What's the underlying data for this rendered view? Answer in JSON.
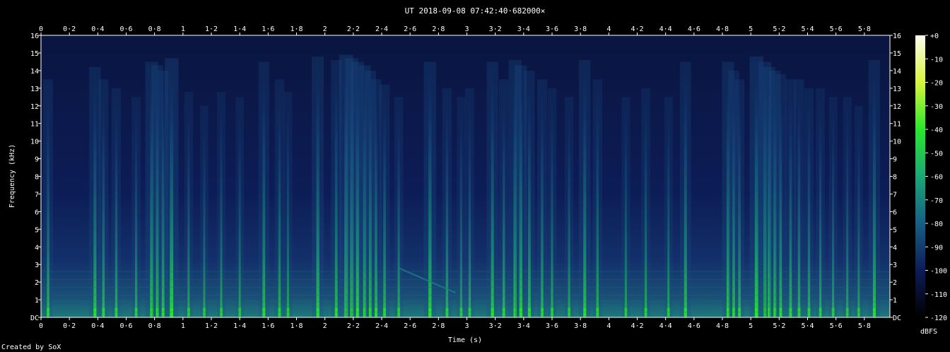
{
  "title": "UT 2018-09-08 07:42:40·682000×",
  "credit": "Created by SoX",
  "chart_data": {
    "type": "heatmap",
    "title": "UT 2018-09-08 07:42:40·682000×",
    "xlabel": "Time (s)",
    "ylabel": "Frequency (kHz)",
    "xlim": [
      0,
      5.98
    ],
    "ylim": [
      0,
      16
    ],
    "x_ticks": [
      "0",
      "0·2",
      "0·4",
      "0·6",
      "0·8",
      "1",
      "1·2",
      "1·4",
      "1·6",
      "1·8",
      "2",
      "2·2",
      "2·4",
      "2·6",
      "2·8",
      "3",
      "3·2",
      "3·4",
      "3·6",
      "3·8",
      "4",
      "4·2",
      "4·4",
      "4·6",
      "4·8",
      "5",
      "5·2",
      "5·4",
      "5·6",
      "5·8"
    ],
    "x_tick_values": [
      0,
      0.2,
      0.4,
      0.6,
      0.8,
      1.0,
      1.2,
      1.4,
      1.6,
      1.8,
      2.0,
      2.2,
      2.4,
      2.6,
      2.8,
      3.0,
      3.2,
      3.4,
      3.6,
      3.8,
      4.0,
      4.2,
      4.4,
      4.6,
      4.8,
      5.0,
      5.2,
      5.4,
      5.6,
      5.8
    ],
    "y_ticks": [
      "DC",
      "1",
      "2",
      "3",
      "4",
      "5",
      "6",
      "7",
      "8",
      "9",
      "10",
      "11",
      "12",
      "13",
      "14",
      "15",
      "16"
    ],
    "y_tick_values": [
      0,
      1,
      2,
      3,
      4,
      5,
      6,
      7,
      8,
      9,
      10,
      11,
      12,
      13,
      14,
      15,
      16
    ],
    "colorbar": {
      "label": "dBFS",
      "ticks": [
        "+0",
        "-10",
        "-20",
        "-30",
        "-40",
        "-50",
        "-60",
        "-70",
        "-80",
        "-90",
        "-100",
        "-110",
        "-120"
      ],
      "range": [
        -120,
        0
      ],
      "colors": [
        "#fdfdf0",
        "#d8f53a",
        "#27e82b",
        "#1ba776",
        "#155f86",
        "#0d1c58",
        "#000000"
      ]
    },
    "background_color": "#0a1540",
    "transients": [
      {
        "t": 0.05,
        "top": 13.5,
        "amp": 0.5
      },
      {
        "t": 0.38,
        "top": 14.2,
        "amp": 0.7
      },
      {
        "t": 0.44,
        "top": 13.5,
        "amp": 0.5
      },
      {
        "t": 0.53,
        "top": 13.0,
        "amp": 0.45
      },
      {
        "t": 0.67,
        "top": 12.5,
        "amp": 0.4
      },
      {
        "t": 0.78,
        "top": 14.5,
        "amp": 0.85
      },
      {
        "t": 0.82,
        "top": 14.3,
        "amp": 0.7
      },
      {
        "t": 0.86,
        "top": 14.0,
        "amp": 0.6
      },
      {
        "t": 0.92,
        "top": 14.7,
        "amp": 0.95
      },
      {
        "t": 1.04,
        "top": 12.8,
        "amp": 0.35
      },
      {
        "t": 1.15,
        "top": 12.0,
        "amp": 0.3
      },
      {
        "t": 1.27,
        "top": 12.8,
        "amp": 0.35
      },
      {
        "t": 1.4,
        "top": 12.5,
        "amp": 0.3
      },
      {
        "t": 1.57,
        "top": 14.5,
        "amp": 0.6
      },
      {
        "t": 1.68,
        "top": 13.5,
        "amp": 0.45
      },
      {
        "t": 1.74,
        "top": 12.8,
        "amp": 0.35
      },
      {
        "t": 1.95,
        "top": 14.8,
        "amp": 0.75
      },
      {
        "t": 2.08,
        "top": 14.6,
        "amp": 0.6
      },
      {
        "t": 2.15,
        "top": 14.9,
        "amp": 1.0
      },
      {
        "t": 2.19,
        "top": 14.7,
        "amp": 0.9
      },
      {
        "t": 2.23,
        "top": 14.5,
        "amp": 0.85
      },
      {
        "t": 2.28,
        "top": 14.3,
        "amp": 0.75
      },
      {
        "t": 2.32,
        "top": 14.0,
        "amp": 0.7
      },
      {
        "t": 2.36,
        "top": 13.5,
        "amp": 0.6
      },
      {
        "t": 2.42,
        "top": 13.2,
        "amp": 0.55
      },
      {
        "t": 2.52,
        "top": 12.5,
        "amp": 0.4
      },
      {
        "t": 2.74,
        "top": 14.5,
        "amp": 0.8
      },
      {
        "t": 2.86,
        "top": 13.0,
        "amp": 0.45
      },
      {
        "t": 2.96,
        "top": 12.5,
        "amp": 0.35
      },
      {
        "t": 3.02,
        "top": 13.0,
        "amp": 0.4
      },
      {
        "t": 3.18,
        "top": 14.5,
        "amp": 0.7
      },
      {
        "t": 3.26,
        "top": 13.5,
        "amp": 0.5
      },
      {
        "t": 3.34,
        "top": 14.6,
        "amp": 0.85
      },
      {
        "t": 3.38,
        "top": 14.3,
        "amp": 0.75
      },
      {
        "t": 3.44,
        "top": 14.0,
        "amp": 0.6
      },
      {
        "t": 3.53,
        "top": 13.5,
        "amp": 0.5
      },
      {
        "t": 3.6,
        "top": 13.0,
        "amp": 0.4
      },
      {
        "t": 3.72,
        "top": 12.5,
        "amp": 0.35
      },
      {
        "t": 3.83,
        "top": 14.6,
        "amp": 0.7
      },
      {
        "t": 3.92,
        "top": 13.5,
        "amp": 0.45
      },
      {
        "t": 4.12,
        "top": 12.5,
        "amp": 0.35
      },
      {
        "t": 4.26,
        "top": 13.0,
        "amp": 0.4
      },
      {
        "t": 4.42,
        "top": 12.5,
        "amp": 0.35
      },
      {
        "t": 4.54,
        "top": 14.5,
        "amp": 0.65
      },
      {
        "t": 4.84,
        "top": 14.5,
        "amp": 0.75
      },
      {
        "t": 4.88,
        "top": 14.0,
        "amp": 0.6
      },
      {
        "t": 4.92,
        "top": 13.5,
        "amp": 0.5
      },
      {
        "t": 5.04,
        "top": 14.8,
        "amp": 0.95
      },
      {
        "t": 5.1,
        "top": 14.5,
        "amp": 0.85
      },
      {
        "t": 5.13,
        "top": 14.2,
        "amp": 0.75
      },
      {
        "t": 5.17,
        "top": 14.0,
        "amp": 0.7
      },
      {
        "t": 5.21,
        "top": 13.8,
        "amp": 0.6
      },
      {
        "t": 5.28,
        "top": 13.5,
        "amp": 0.55
      },
      {
        "t": 5.34,
        "top": 13.5,
        "amp": 0.5
      },
      {
        "t": 5.41,
        "top": 13.0,
        "amp": 0.45
      },
      {
        "t": 5.49,
        "top": 13.0,
        "amp": 0.4
      },
      {
        "t": 5.58,
        "top": 12.5,
        "amp": 0.35
      },
      {
        "t": 5.68,
        "top": 12.5,
        "amp": 0.35
      },
      {
        "t": 5.76,
        "top": 12.0,
        "amp": 0.3
      },
      {
        "t": 5.87,
        "top": 14.6,
        "amp": 0.7
      }
    ],
    "sweep": {
      "t_start": 2.52,
      "t_end": 2.92,
      "f_start": 2.8,
      "f_end": 1.4
    }
  }
}
